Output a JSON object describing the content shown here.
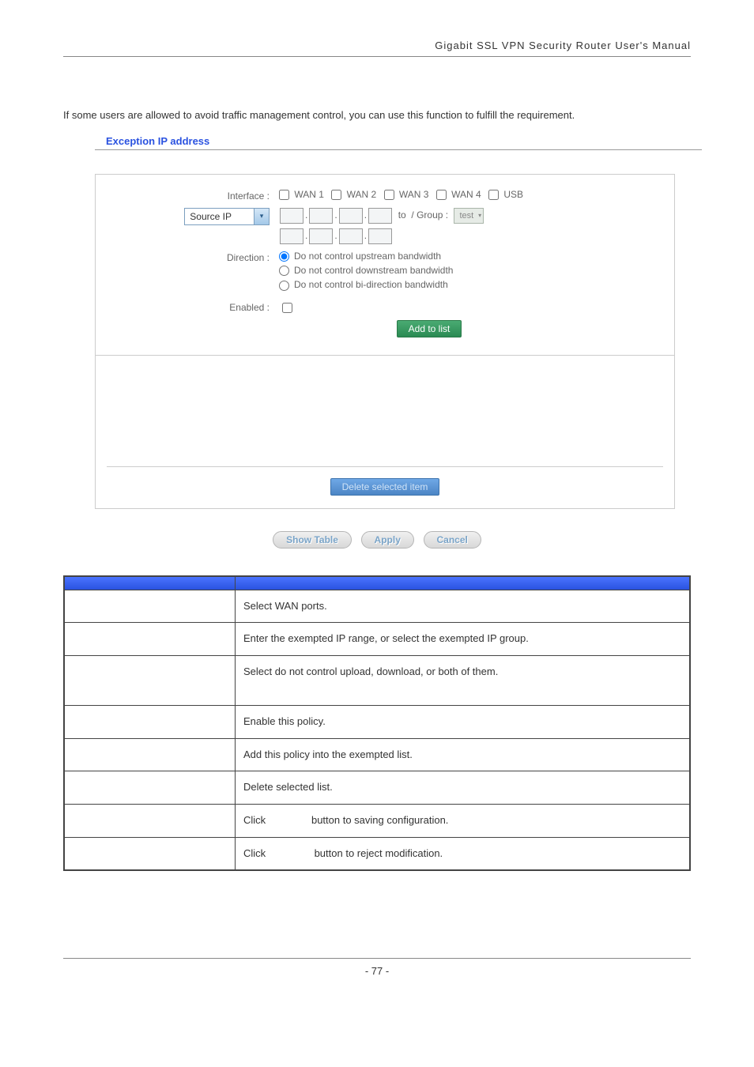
{
  "header": "Gigabit  SSL  VPN  Security  Router  User's  Manual",
  "intro": "If some users are allowed to avoid traffic management control, you can use this function to fulfill the requirement.",
  "section_title": "Exception IP address",
  "form": {
    "interface_label": "Interface :",
    "interfaces": [
      "WAN 1",
      "WAN 2",
      "WAN 3",
      "WAN 4",
      "USB"
    ],
    "source_select": "Source IP",
    "to_label": "to",
    "group_label": " / Group :",
    "group_value": "test",
    "direction_label": "Direction :",
    "radios": [
      "Do not control upstream bandwidth",
      "Do not control downstream bandwidth",
      "Do not control bi-direction bandwidth"
    ],
    "enabled_label": "Enabled :",
    "add_btn": "Add to list",
    "delete_btn": "Delete selected item"
  },
  "bottom_buttons": [
    "Show Table",
    "Apply",
    "Cancel"
  ],
  "table": {
    "header_item": "",
    "header_desc": "",
    "rows": [
      {
        "item": "",
        "desc": "Select WAN ports."
      },
      {
        "item": "",
        "desc": "Enter the exempted IP range, or select the exempted IP group."
      },
      {
        "item": "",
        "desc": "Select do not control upload, download, or both of them."
      },
      {
        "item": "",
        "desc": "Enable this policy."
      },
      {
        "item": "",
        "desc": "Add this policy into the exempted list."
      },
      {
        "item": "",
        "desc": "Delete selected list."
      },
      {
        "item": "",
        "desc_pre": "Click",
        "desc_post": "button to saving configuration."
      },
      {
        "item": "",
        "desc_pre": "Click",
        "desc_post": "button to reject modification."
      }
    ]
  },
  "page_number": "- 77 -"
}
